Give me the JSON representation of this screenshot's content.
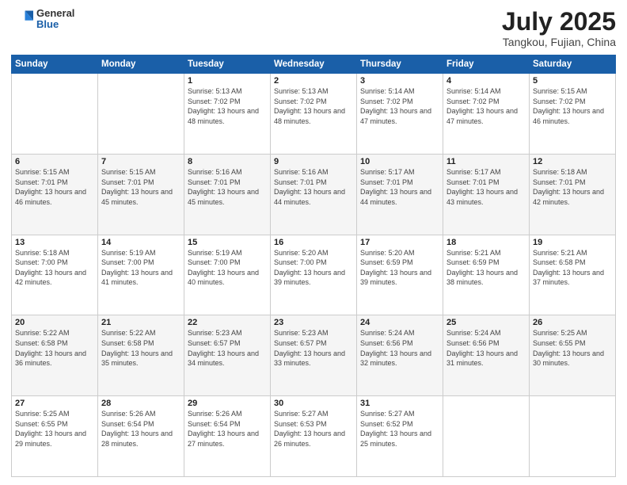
{
  "header": {
    "logo_general": "General",
    "logo_blue": "Blue",
    "title": "July 2025",
    "location": "Tangkou, Fujian, China"
  },
  "weekdays": [
    "Sunday",
    "Monday",
    "Tuesday",
    "Wednesday",
    "Thursday",
    "Friday",
    "Saturday"
  ],
  "weeks": [
    [
      {
        "day": "",
        "info": ""
      },
      {
        "day": "",
        "info": ""
      },
      {
        "day": "1",
        "info": "Sunrise: 5:13 AM\nSunset: 7:02 PM\nDaylight: 13 hours and 48 minutes."
      },
      {
        "day": "2",
        "info": "Sunrise: 5:13 AM\nSunset: 7:02 PM\nDaylight: 13 hours and 48 minutes."
      },
      {
        "day": "3",
        "info": "Sunrise: 5:14 AM\nSunset: 7:02 PM\nDaylight: 13 hours and 47 minutes."
      },
      {
        "day": "4",
        "info": "Sunrise: 5:14 AM\nSunset: 7:02 PM\nDaylight: 13 hours and 47 minutes."
      },
      {
        "day": "5",
        "info": "Sunrise: 5:15 AM\nSunset: 7:02 PM\nDaylight: 13 hours and 46 minutes."
      }
    ],
    [
      {
        "day": "6",
        "info": "Sunrise: 5:15 AM\nSunset: 7:01 PM\nDaylight: 13 hours and 46 minutes."
      },
      {
        "day": "7",
        "info": "Sunrise: 5:15 AM\nSunset: 7:01 PM\nDaylight: 13 hours and 45 minutes."
      },
      {
        "day": "8",
        "info": "Sunrise: 5:16 AM\nSunset: 7:01 PM\nDaylight: 13 hours and 45 minutes."
      },
      {
        "day": "9",
        "info": "Sunrise: 5:16 AM\nSunset: 7:01 PM\nDaylight: 13 hours and 44 minutes."
      },
      {
        "day": "10",
        "info": "Sunrise: 5:17 AM\nSunset: 7:01 PM\nDaylight: 13 hours and 44 minutes."
      },
      {
        "day": "11",
        "info": "Sunrise: 5:17 AM\nSunset: 7:01 PM\nDaylight: 13 hours and 43 minutes."
      },
      {
        "day": "12",
        "info": "Sunrise: 5:18 AM\nSunset: 7:01 PM\nDaylight: 13 hours and 42 minutes."
      }
    ],
    [
      {
        "day": "13",
        "info": "Sunrise: 5:18 AM\nSunset: 7:00 PM\nDaylight: 13 hours and 42 minutes."
      },
      {
        "day": "14",
        "info": "Sunrise: 5:19 AM\nSunset: 7:00 PM\nDaylight: 13 hours and 41 minutes."
      },
      {
        "day": "15",
        "info": "Sunrise: 5:19 AM\nSunset: 7:00 PM\nDaylight: 13 hours and 40 minutes."
      },
      {
        "day": "16",
        "info": "Sunrise: 5:20 AM\nSunset: 7:00 PM\nDaylight: 13 hours and 39 minutes."
      },
      {
        "day": "17",
        "info": "Sunrise: 5:20 AM\nSunset: 6:59 PM\nDaylight: 13 hours and 39 minutes."
      },
      {
        "day": "18",
        "info": "Sunrise: 5:21 AM\nSunset: 6:59 PM\nDaylight: 13 hours and 38 minutes."
      },
      {
        "day": "19",
        "info": "Sunrise: 5:21 AM\nSunset: 6:58 PM\nDaylight: 13 hours and 37 minutes."
      }
    ],
    [
      {
        "day": "20",
        "info": "Sunrise: 5:22 AM\nSunset: 6:58 PM\nDaylight: 13 hours and 36 minutes."
      },
      {
        "day": "21",
        "info": "Sunrise: 5:22 AM\nSunset: 6:58 PM\nDaylight: 13 hours and 35 minutes."
      },
      {
        "day": "22",
        "info": "Sunrise: 5:23 AM\nSunset: 6:57 PM\nDaylight: 13 hours and 34 minutes."
      },
      {
        "day": "23",
        "info": "Sunrise: 5:23 AM\nSunset: 6:57 PM\nDaylight: 13 hours and 33 minutes."
      },
      {
        "day": "24",
        "info": "Sunrise: 5:24 AM\nSunset: 6:56 PM\nDaylight: 13 hours and 32 minutes."
      },
      {
        "day": "25",
        "info": "Sunrise: 5:24 AM\nSunset: 6:56 PM\nDaylight: 13 hours and 31 minutes."
      },
      {
        "day": "26",
        "info": "Sunrise: 5:25 AM\nSunset: 6:55 PM\nDaylight: 13 hours and 30 minutes."
      }
    ],
    [
      {
        "day": "27",
        "info": "Sunrise: 5:25 AM\nSunset: 6:55 PM\nDaylight: 13 hours and 29 minutes."
      },
      {
        "day": "28",
        "info": "Sunrise: 5:26 AM\nSunset: 6:54 PM\nDaylight: 13 hours and 28 minutes."
      },
      {
        "day": "29",
        "info": "Sunrise: 5:26 AM\nSunset: 6:54 PM\nDaylight: 13 hours and 27 minutes."
      },
      {
        "day": "30",
        "info": "Sunrise: 5:27 AM\nSunset: 6:53 PM\nDaylight: 13 hours and 26 minutes."
      },
      {
        "day": "31",
        "info": "Sunrise: 5:27 AM\nSunset: 6:52 PM\nDaylight: 13 hours and 25 minutes."
      },
      {
        "day": "",
        "info": ""
      },
      {
        "day": "",
        "info": ""
      }
    ]
  ]
}
